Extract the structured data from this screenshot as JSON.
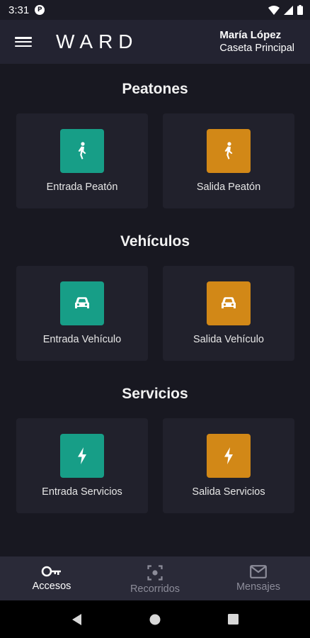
{
  "status_bar": {
    "time": "3:31"
  },
  "app_bar": {
    "logo": "WARD",
    "user_name": "María López",
    "user_post": "Caseta Principal"
  },
  "sections": [
    {
      "title": "Peatones",
      "cards": [
        {
          "label": "Entrada Peatón",
          "icon": "walking-person-icon"
        },
        {
          "label": "Salida Peatón",
          "icon": "walking-person-icon"
        }
      ]
    },
    {
      "title": "Vehículos",
      "cards": [
        {
          "label": "Entrada Vehículo",
          "icon": "car-icon"
        },
        {
          "label": "Salida Vehículo",
          "icon": "car-icon"
        }
      ]
    },
    {
      "title": "Servicios",
      "cards": [
        {
          "label": "Entrada Servicios",
          "icon": "lightning-bolt-icon"
        },
        {
          "label": "Salida Servicios",
          "icon": "lightning-bolt-icon"
        }
      ]
    }
  ],
  "bottom_nav": [
    {
      "label": "Accesos",
      "icon": "key-icon",
      "active": true
    },
    {
      "label": "Recorridos",
      "icon": "scan-icon",
      "active": false
    },
    {
      "label": "Mensajes",
      "icon": "mail-icon",
      "active": false
    }
  ],
  "colors": {
    "entry": "#179e87",
    "exit": "#d28817",
    "background": "#181821",
    "card": "#21212c",
    "app_bar": "#232331"
  }
}
